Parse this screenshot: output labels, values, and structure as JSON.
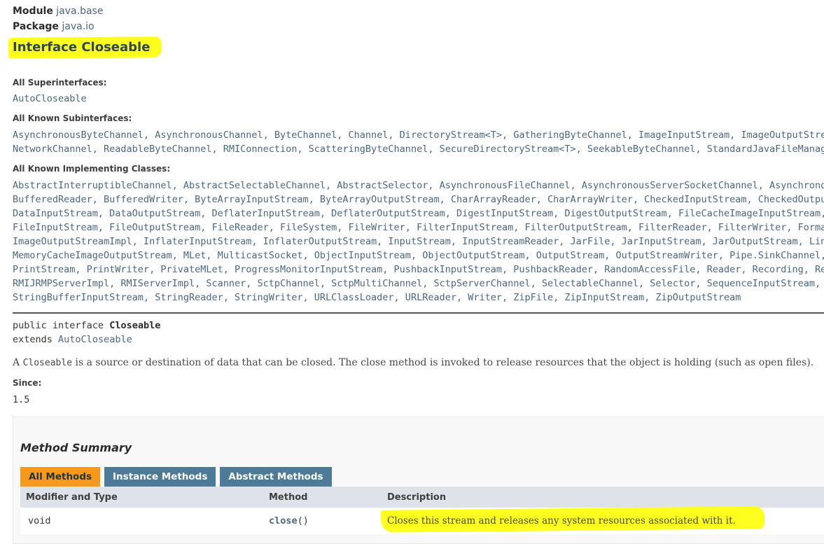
{
  "header": {
    "module_label": "Module",
    "module_value": "java.base",
    "package_label": "Package",
    "package_value": "java.io",
    "title": "Interface Closeable"
  },
  "superinterfaces": {
    "label": "All Superinterfaces:",
    "line1": "AutoCloseable"
  },
  "subinterfaces": {
    "label": "All Known Subinterfaces:",
    "line1": "AsynchronousByteChannel, AsynchronousChannel, ByteChannel, Channel, DirectoryStream<T>, GatheringByteChannel, ImageInputStream, ImageOutputStream",
    "line2": "NetworkChannel, ReadableByteChannel, RMIConnection, ScatteringByteChannel, SecureDirectoryStream<T>, SeekableByteChannel, StandardJavaFileManager"
  },
  "implementing": {
    "label": "All Known Implementing Classes:",
    "line1": "AbstractInterruptibleChannel, AbstractSelectableChannel, AbstractSelector, AsynchronousFileChannel, AsynchronousServerSocketChannel, Asynchrono",
    "line2": "BufferedReader, BufferedWriter, ByteArrayInputStream, ByteArrayOutputStream, CharArrayReader, CharArrayWriter, CheckedInputStream, CheckedOutputS",
    "line3": "DataInputStream, DataOutputStream, DeflaterInputStream, DeflaterOutputStream, DigestInputStream, DigestOutputStream, FileCacheImageInputStream, F",
    "line4": "FileInputStream, FileOutputStream, FileReader, FileSystem, FileWriter, FilterInputStream, FilterOutputStream, FilterReader, FilterWriter, Formatte",
    "line5": "ImageOutputStreamImpl, InflaterInputStream, InflaterOutputStream, InputStream, InputStreamReader, JarFile, JarInputStream, JarOutputStream, LineNu",
    "line6": "MemoryCacheImageOutputStream, MLet, MulticastSocket, ObjectInputStream, ObjectOutputStream, OutputStream, OutputStreamWriter, Pipe.SinkChannel, Pi",
    "line7": "PrintStream, PrintWriter, PrivateMLet, ProgressMonitorInputStream, PushbackInputStream, PushbackReader, RandomAccessFile, Reader, Recording, Record",
    "line8": "RMIJRMPServerImpl, RMIServerImpl, Scanner, SctpChannel, SctpMultiChannel, SctpServerChannel, SelectableChannel, Selector, SequenceInputStream, Serv",
    "line9": "StringBufferInputStream, StringReader, StringWriter, URLClassLoader, URLReader, Writer, ZipFile, ZipInputStream, ZipOutputStream"
  },
  "signature": {
    "line1_prefix": "public interface",
    "name": "Closeable",
    "line2_prefix": "extends",
    "extends": "AutoCloseable"
  },
  "description": {
    "prefix": "A",
    "code1": "Closeable",
    "middle": "is a source or destination of data that can be closed. The close method is invoked to release resources that the object is holding (such as open files)."
  },
  "since": {
    "label": "Since:",
    "value": "1.5"
  },
  "method_summary": {
    "title": "Method Summary",
    "tabs": [
      "All Methods",
      "Instance Methods",
      "Abstract Methods"
    ],
    "columns": [
      "Modifier and Type",
      "Method",
      "Description"
    ],
    "rows": [
      {
        "type": "void",
        "method": "close",
        "params": "()",
        "description": "Closes this stream and releases any system resources associated with it."
      }
    ]
  },
  "colors": {
    "highlight": "#ffff1f",
    "link": "#4a6782",
    "active_tab": "#f8981d",
    "tab": "#4d7a97",
    "table_header": "#dee3e9"
  }
}
